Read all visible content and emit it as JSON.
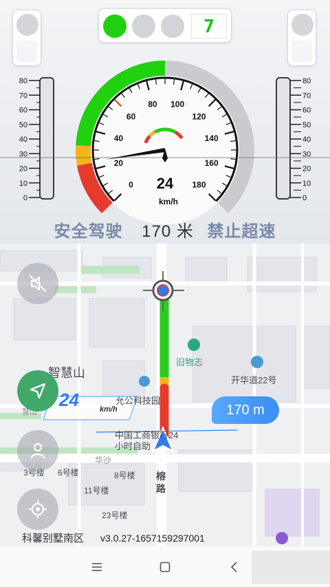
{
  "colors": {
    "accent_green": "#21d00f",
    "caution_yellow": "#f2b51c",
    "danger_red": "#e53b2b",
    "gauge_gray": "#c9cbcf",
    "nav_blue": "#2f7cf0"
  },
  "signal": {
    "countdown": "7",
    "lights": [
      "green",
      "off",
      "off"
    ]
  },
  "left_bar": {
    "ticks": [
      "80",
      "70",
      "60",
      "50",
      "40",
      "30",
      "20",
      "10",
      "0"
    ]
  },
  "right_bar": {
    "ticks": [
      "80",
      "70",
      "60",
      "50",
      "40",
      "30",
      "20",
      "10",
      "0"
    ]
  },
  "speedometer": {
    "speed": "24",
    "unit": "km/h",
    "max": 180,
    "needle_value": 24,
    "ticks": [
      "0",
      "20",
      "40",
      "60",
      "80",
      "100",
      "120",
      "140",
      "160",
      "180"
    ]
  },
  "notice": {
    "prefix": "安全驾驶",
    "distance": "170 米",
    "suffix": "禁止超速"
  },
  "map": {
    "labels": {
      "zhihui": "智慧山",
      "jiuwu": "旧物志",
      "kaihua": "开华道22号",
      "keji": "允公科技园",
      "bank1": "中国工商银行24",
      "bank2": "小时自助",
      "b3": "3号楼",
      "b6": "6号楼",
      "b8": "8号楼",
      "b11": "11号楼",
      "b23": "23号楼",
      "rong1": "榕",
      "rong2": "路",
      "huasha": "华沙",
      "huisha": "慧山",
      "district": "科馨别墅南区"
    },
    "speed_overlay": {
      "value": "24",
      "unit": "km/h"
    },
    "distance_callout": "170 m",
    "version": "v3.0.27-1657159297001"
  },
  "icons": {
    "mute": "speaker-muted-icon",
    "nav": "navigation-arrow-icon",
    "person": "person-icon",
    "locate": "locate-target-icon",
    "menu": "menu-lines-icon",
    "home": "home-square-icon",
    "back": "back-chevron-icon"
  }
}
